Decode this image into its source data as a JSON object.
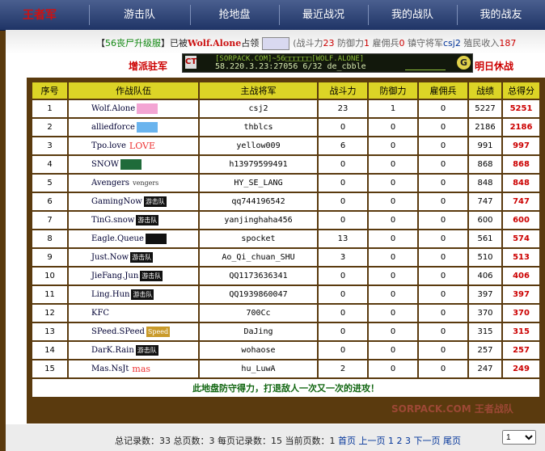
{
  "nav": {
    "logo": "王者军",
    "items": [
      "游击队",
      "抢地盘",
      "最近战况",
      "我的战队",
      "我的战友"
    ]
  },
  "ticker": {
    "open": "【",
    "server": "56丧尸升级服",
    "close": "】已被",
    "team": "Wolf.Alone",
    "occupied": "占领",
    "stats_open": "(战斗力",
    "power": "23",
    "def_label": "防御力",
    "defense": "1",
    "merc_label": "雇佣兵",
    "mercs": "0",
    "general_label": "镇守将军",
    "general": "csj2",
    "income_label": "殖民收入",
    "income": "187"
  },
  "actions": {
    "reinforce": "增派驻军",
    "rest": "明日休战"
  },
  "server_banner": {
    "line1": "[SORPACK.COM]~56□□□□□□[WOLF.ALONE]",
    "line2": "58.220.3.23:27056   6/32   de_cbble",
    "icon": "CT",
    "gs": "G"
  },
  "table": {
    "headers": [
      "序号",
      "作战队伍",
      "主战将军",
      "战斗力",
      "防御力",
      "雇佣兵",
      "战绩",
      "总得分"
    ],
    "rows": [
      {
        "rank": "1",
        "team": "Wolf.Alone",
        "badge": "",
        "badge_style": "b-pink",
        "general": "csj2",
        "power": "23",
        "defense": "1",
        "mercs": "0",
        "record": "5227",
        "total": "5251"
      },
      {
        "rank": "2",
        "team": "alliedforce",
        "badge": "",
        "badge_style": "b-blue",
        "general": "thblcs",
        "power": "0",
        "defense": "0",
        "mercs": "0",
        "record": "2186",
        "total": "2186"
      },
      {
        "rank": "3",
        "team": "Tpo.love",
        "badge": "LOVE",
        "badge_style": "b-love",
        "general": "yellow009",
        "power": "6",
        "defense": "0",
        "mercs": "0",
        "record": "991",
        "total": "997"
      },
      {
        "rank": "4",
        "team": "SNOW",
        "badge": "",
        "badge_style": "b-green",
        "general": "h13979599491",
        "power": "0",
        "defense": "0",
        "mercs": "0",
        "record": "868",
        "total": "868"
      },
      {
        "rank": "5",
        "team": "Avengers",
        "badge": "vengers",
        "badge_style": "b-white",
        "general": "HY_SE_LANG",
        "power": "0",
        "defense": "0",
        "mercs": "0",
        "record": "848",
        "total": "848"
      },
      {
        "rank": "6",
        "team": "GamingNow",
        "badge": "游击队",
        "badge_style": "b-black",
        "general": "qq744196542",
        "power": "0",
        "defense": "0",
        "mercs": "0",
        "record": "747",
        "total": "747"
      },
      {
        "rank": "7",
        "team": "TinG.snow",
        "badge": "游击队",
        "badge_style": "b-black",
        "general": "yanjinghaha456",
        "power": "0",
        "defense": "0",
        "mercs": "0",
        "record": "600",
        "total": "600"
      },
      {
        "rank": "8",
        "team": "Eagle.Queue",
        "badge": "",
        "badge_style": "b-black",
        "general": "spocket",
        "power": "13",
        "defense": "0",
        "mercs": "0",
        "record": "561",
        "total": "574"
      },
      {
        "rank": "9",
        "team": "Just.Now",
        "badge": "游击队",
        "badge_style": "b-black",
        "general": "Ao_Qi_chuan_SHU",
        "power": "3",
        "defense": "0",
        "mercs": "0",
        "record": "510",
        "total": "513"
      },
      {
        "rank": "10",
        "team": "JieFang.Jun",
        "badge": "游击队",
        "badge_style": "b-black",
        "general": "QQ1173636341",
        "power": "0",
        "defense": "0",
        "mercs": "0",
        "record": "406",
        "total": "406"
      },
      {
        "rank": "11",
        "team": "Ling.Hun",
        "badge": "游击队",
        "badge_style": "b-black",
        "general": "QQ1939860047",
        "power": "0",
        "defense": "0",
        "mercs": "0",
        "record": "397",
        "total": "397"
      },
      {
        "rank": "12",
        "team": "KFC",
        "badge": "",
        "badge_style": "b-white",
        "general": "700Cc",
        "power": "0",
        "defense": "0",
        "mercs": "0",
        "record": "370",
        "total": "370"
      },
      {
        "rank": "13",
        "team": "SPeed.SPeed",
        "badge": "Speed",
        "badge_style": "b-gold",
        "general": "DaJing",
        "power": "0",
        "defense": "0",
        "mercs": "0",
        "record": "315",
        "total": "315"
      },
      {
        "rank": "14",
        "team": "DarK.Rain",
        "badge": "游击队",
        "badge_style": "b-black",
        "general": "wohaose",
        "power": "0",
        "defense": "0",
        "mercs": "0",
        "record": "257",
        "total": "257"
      },
      {
        "rank": "15",
        "team": "Mas.NsJt",
        "badge": "mas",
        "badge_style": "b-mas",
        "general": "hu_LuwA",
        "power": "2",
        "defense": "0",
        "mercs": "0",
        "record": "247",
        "total": "249"
      }
    ],
    "slogan": "此地盘防守得力，打退敌人一次又一次的进攻！"
  },
  "footer": {
    "total_records_label": "总记录数：",
    "total_records": "33",
    "total_pages_label": "总页数：",
    "total_pages": "3",
    "per_page_label": "每页记录数：",
    "per_page": "15",
    "current_label": "当前页数：",
    "current": "1",
    "first": "首页",
    "prev": "上一页",
    "pages": [
      "1",
      "2",
      "3"
    ],
    "next": "下一页",
    "last": "尾页",
    "select_value": "1"
  },
  "watermark": "SORPACK.COM 王者战队"
}
